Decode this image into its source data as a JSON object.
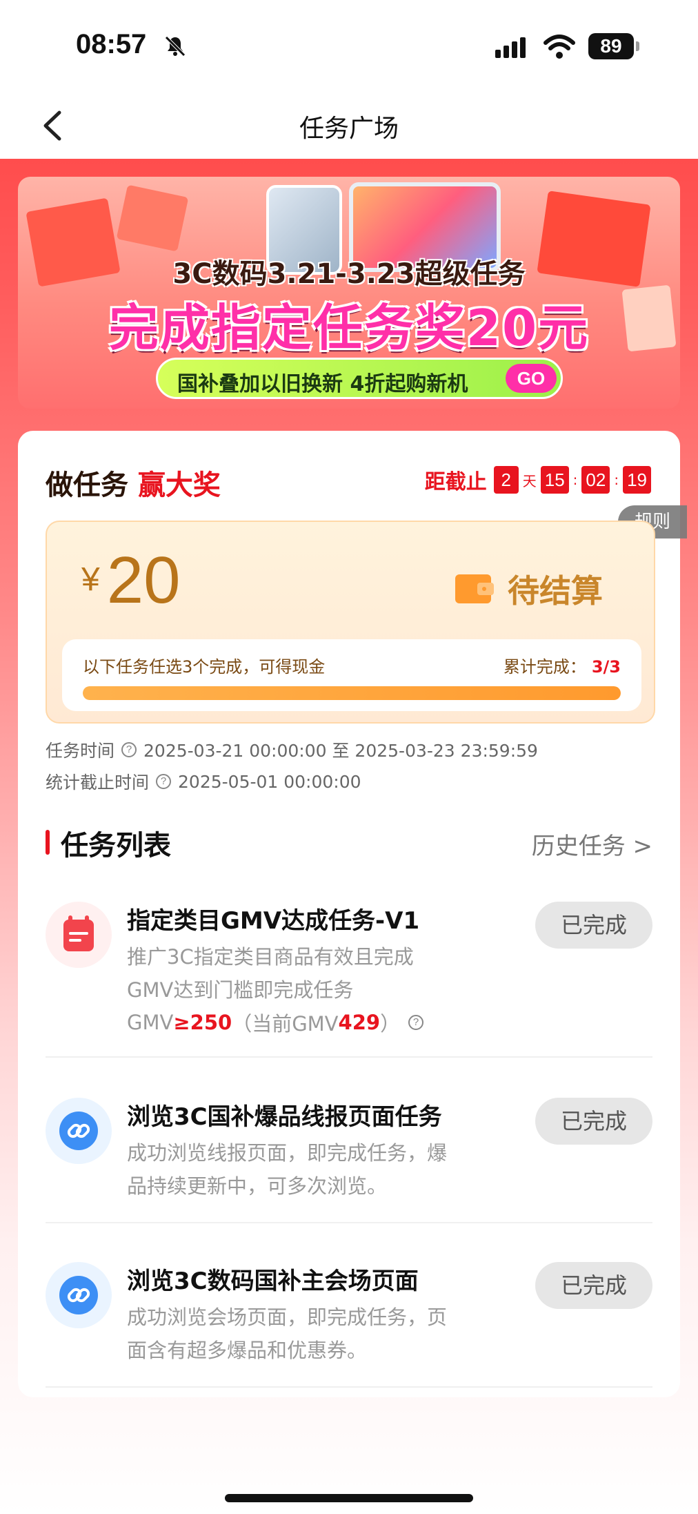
{
  "status_bar": {
    "time": "08:57",
    "battery": "89"
  },
  "nav": {
    "title": "任务广场"
  },
  "banner": {
    "line1": "3C数码3.21-3.23超级任务",
    "line2": "完成指定任务奖20元",
    "pill_text": "国补叠加以旧换新 4折起购新机",
    "go_label": "GO"
  },
  "promo": {
    "title_prefix": "做任务",
    "title_highlight": "赢大奖",
    "deadline_label": "距截止",
    "countdown": {
      "days": "2",
      "day_unit": "天",
      "hours": "15",
      "minutes": "02",
      "seconds": "19",
      "separator": ":"
    },
    "rules_label": "规则"
  },
  "reward": {
    "currency": "¥",
    "amount": "20",
    "status": "待结算",
    "description": "以下任务任选3个完成，可得现金",
    "progress_label": "累计完成：",
    "progress_value": "3/3",
    "progress_fraction": 1.0
  },
  "meta": {
    "task_time_label": "任务时间",
    "task_time_value": "2025-03-21 00:00:00 至 2025-03-23 23:59:59",
    "stat_deadline_label": "统计截止时间",
    "stat_deadline_value": "2025-05-01 00:00:00"
  },
  "task_list": {
    "title": "任务列表",
    "history_link": "历史任务 >",
    "items": [
      {
        "title": "指定类目GMV达成任务-V1",
        "desc_line1": "推广3C指定类目商品有效且完成",
        "desc_line2": "GMV达到门槛即完成任务",
        "gmv_prefix": "GMV",
        "gmv_threshold": "≥250",
        "gmv_current_prefix": "（当前GMV",
        "gmv_current": "429",
        "gmv_current_suffix": "）",
        "status": "已完成",
        "icon": "calendar-icon"
      },
      {
        "title": "浏览3C国补爆品线报页面任务",
        "desc_line1": "成功浏览线报页面，即完成任务，爆",
        "desc_line2": "品持续更新中，可多次浏览。",
        "status": "已完成",
        "icon": "link-icon"
      },
      {
        "title": "浏览3C数码国补主会场页面",
        "desc_line1": "成功浏览会场页面，即完成任务，页",
        "desc_line2": "面含有超多爆品和优惠券。",
        "status": "已完成",
        "icon": "link-icon"
      }
    ]
  },
  "colors": {
    "brand_red": "#e8141f",
    "reward_gold": "#b8741a",
    "link_blue": "#3d8ff5"
  }
}
